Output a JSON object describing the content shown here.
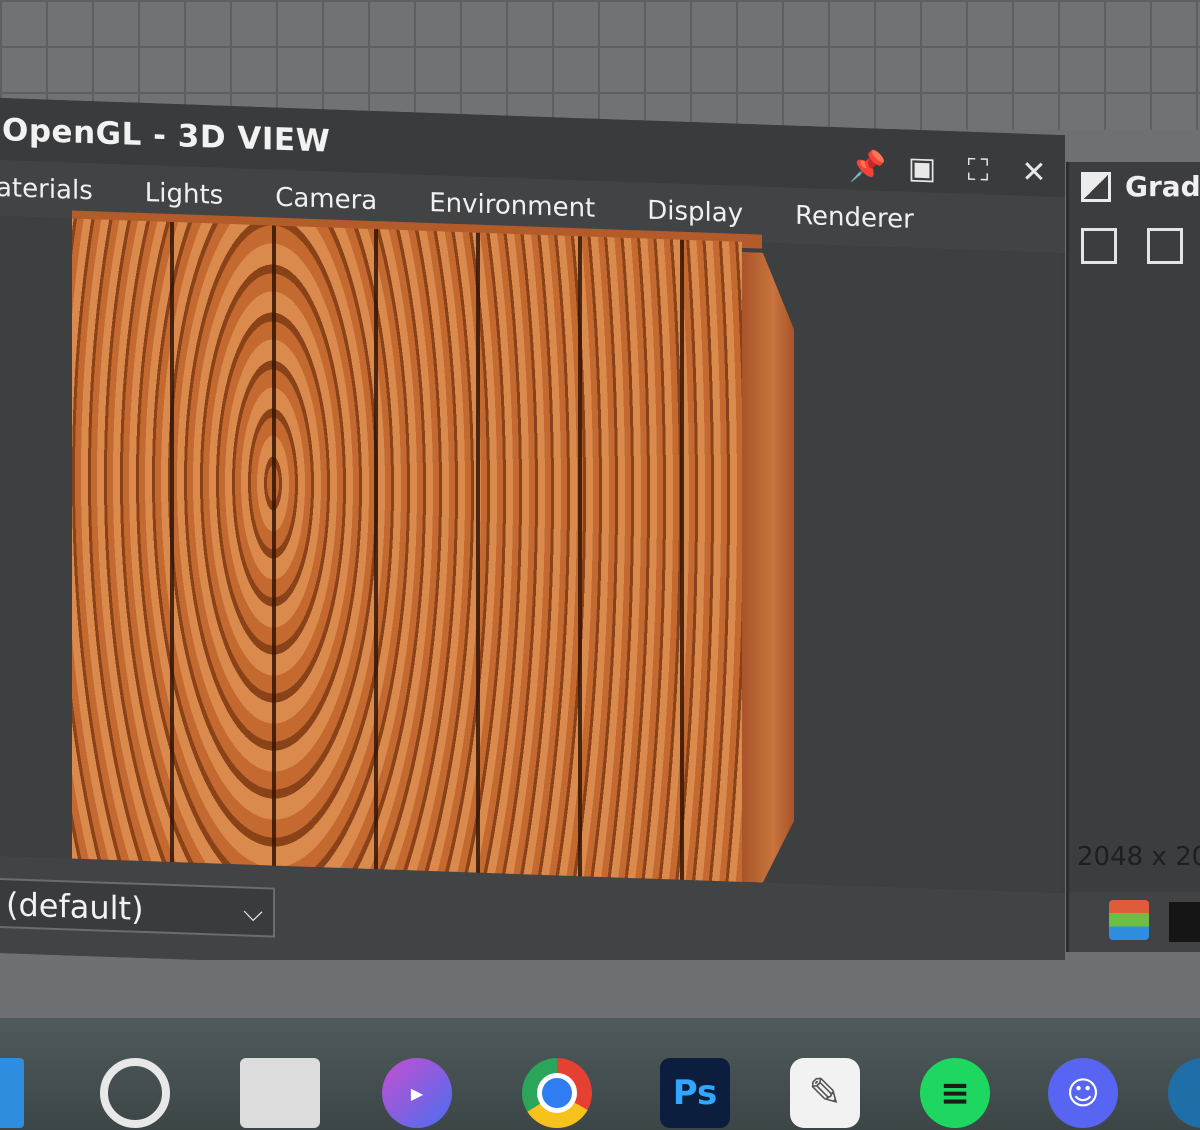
{
  "window": {
    "title": "OpenGL - 3D VIEW",
    "menu": [
      "aterials",
      "Lights",
      "Camera",
      "Environment",
      "Display",
      "Renderer"
    ],
    "icons": [
      "pin-icon",
      "restore-icon",
      "maximize-icon",
      "close-icon"
    ],
    "select_value": "(default)"
  },
  "right_panel": {
    "title": "Gradi",
    "size_label": "2048 x 20"
  },
  "taskbar": {
    "apps": [
      "windows-start-icon",
      "search-icon",
      "task-view-icon",
      "zoom-icon",
      "chrome-icon",
      "photoshop-icon",
      "clip-studio-icon",
      "spotify-icon",
      "discord-icon",
      "steam-icon"
    ],
    "photoshop_label": "Ps"
  },
  "colors": {
    "window_bg": "#3c3d3f",
    "wood": "#c2652c",
    "taskbar": "#465052"
  }
}
